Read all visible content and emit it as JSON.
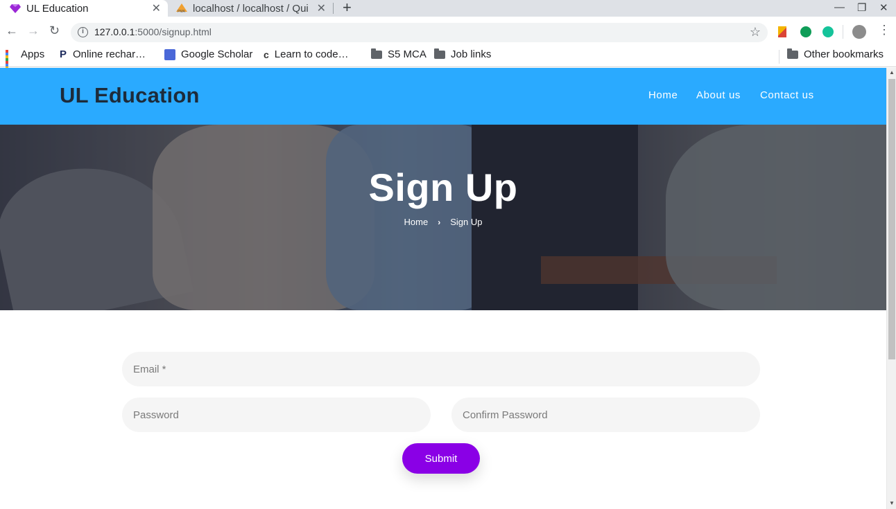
{
  "browser": {
    "tabs": [
      {
        "title": "UL Education",
        "active": true,
        "icon": "gem-icon"
      },
      {
        "title": "localhost / localhost / Qui",
        "active": false,
        "icon": "phpmyadmin-icon"
      }
    ],
    "url": {
      "host": "127.0.0.1",
      "rest": ":5000/signup.html"
    },
    "bookmarks": [
      {
        "label": "Apps",
        "icon": "apps-icon"
      },
      {
        "label": "Online rechar…",
        "icon": "paytm-icon"
      },
      {
        "label": "Google Scholar",
        "icon": "scholar-icon"
      },
      {
        "label": "Learn to code…",
        "icon": "code-icon"
      },
      {
        "label": "S5 MCA",
        "icon": "folder-icon"
      },
      {
        "label": "Job links",
        "icon": "folder-icon"
      }
    ],
    "other_bookmarks": "Other bookmarks"
  },
  "site": {
    "logo": "UL Education",
    "nav": [
      "Home",
      "About us",
      "Contact us"
    ],
    "header_color": "#2aaaff"
  },
  "hero": {
    "title": "Sign Up",
    "breadcrumb": [
      "Home",
      "Sign Up"
    ]
  },
  "form": {
    "email_placeholder": "Email *",
    "password_placeholder": "Password",
    "confirm_placeholder": "Confirm Password",
    "submit_label": "Submit",
    "submit_color": "#8a00e6"
  }
}
